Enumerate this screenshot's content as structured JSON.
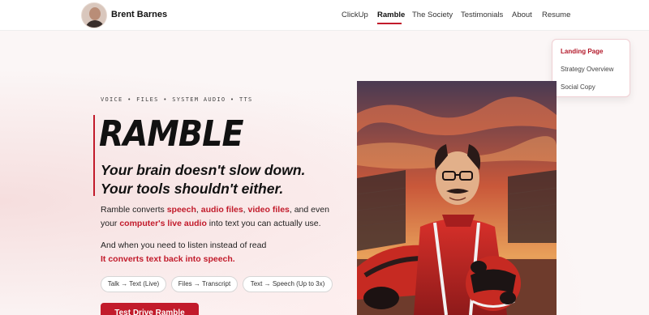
{
  "brand": {
    "name": "Brent Barnes"
  },
  "nav": {
    "items": [
      {
        "label": "ClickUp",
        "active": false
      },
      {
        "label": "Ramble",
        "active": true
      },
      {
        "label": "The Society",
        "active": false
      },
      {
        "label": "Testimonials",
        "active": false
      },
      {
        "label": "About",
        "active": false
      },
      {
        "label": "Resume",
        "active": false
      }
    ],
    "accent": "#c21b2b"
  },
  "dropdown": {
    "items": [
      {
        "label": "Landing Page",
        "active": true
      },
      {
        "label": "Strategy Overview",
        "active": false
      },
      {
        "label": "Social Copy",
        "active": false
      }
    ]
  },
  "hero": {
    "eyebrow": "VOICE • FILES • SYSTEM AUDIO • TTS",
    "title": "RAMBLE",
    "tagline_1": "Your brain doesn't slow down.",
    "tagline_2": "Your tools shouldn't either.",
    "para1": {
      "t1": "Ramble converts ",
      "h1": "speech",
      "t2": ", ",
      "h2": "audio files",
      "t3": ", ",
      "h3": "video files",
      "t4": ", and even",
      "t5": "your ",
      "h4": "computer's live audio",
      "t6": " into text you can actually use."
    },
    "para2": {
      "line1": "And when you need to listen instead of read",
      "line2": "It converts text back into speech."
    },
    "pills": [
      "Talk → Text (Live)",
      "Files → Transcript",
      "Text → Speech (Up to 3x)"
    ],
    "cta": "Test Drive Ramble"
  },
  "illustration": {
    "subject": "racing-driver-illustration",
    "palette": [
      "#c21b2b",
      "#e8733a",
      "#3b2a2a"
    ]
  }
}
